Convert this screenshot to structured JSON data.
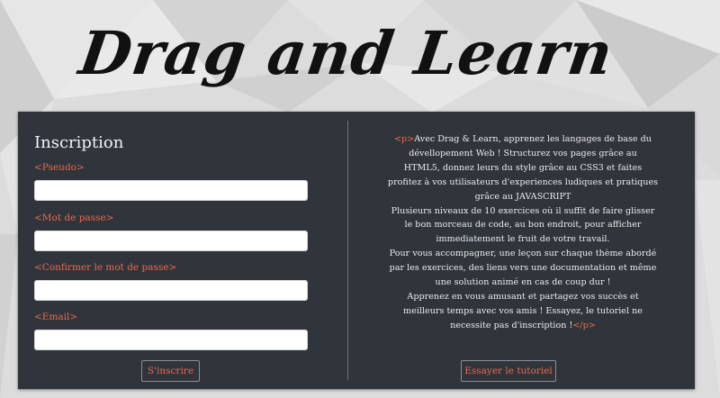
{
  "header": {
    "logo_text": "Drag and Learn"
  },
  "form": {
    "title": "Inscription",
    "fields": [
      {
        "label": "<Pseudo>",
        "value": "",
        "placeholder": ""
      },
      {
        "label": "<Mot de passe>",
        "value": "",
        "placeholder": ""
      },
      {
        "label": "<Confirmer le mot de passe>",
        "value": "",
        "placeholder": ""
      },
      {
        "label": "<Email>",
        "value": "",
        "placeholder": ""
      }
    ],
    "submit_label": "S'inscrire"
  },
  "intro": {
    "open_tag": "<p>",
    "lines": [
      "Avec Drag & Learn, apprenez les langages de base du",
      "dévellopement Web ! Structurez vos pages grâce au",
      "HTML5, donnez leurs du style grâce au CSS3 et faites",
      "profitez à vos utilisateurs d'experiences ludiques et pratiques",
      "grâce au JAVASCRIPT",
      "Plusieurs niveaux de 10 exercices où il suffit de faire glisser",
      "le bon morceau de code, au bon endroit, pour afficher",
      "immediatement le fruit de votre travail.",
      "Pour vous accompagner, une leçon sur chaque thème abordé",
      "par les exercices, des liens vers une documentation et même",
      "une solution animé en cas de coup dur !",
      "Apprenez en vous amusant et partagez vos succès et",
      "meilleurs temps avec vos amis ! Essayez, le tutoriel ne",
      "necessite pas d'inscription !"
    ],
    "close_tag": "</p>",
    "tutorial_button": "Essayer le tutoriel"
  },
  "colors": {
    "panel": "#30343b",
    "accent": "#e96a4c",
    "page_background": "#dcdcdc"
  }
}
